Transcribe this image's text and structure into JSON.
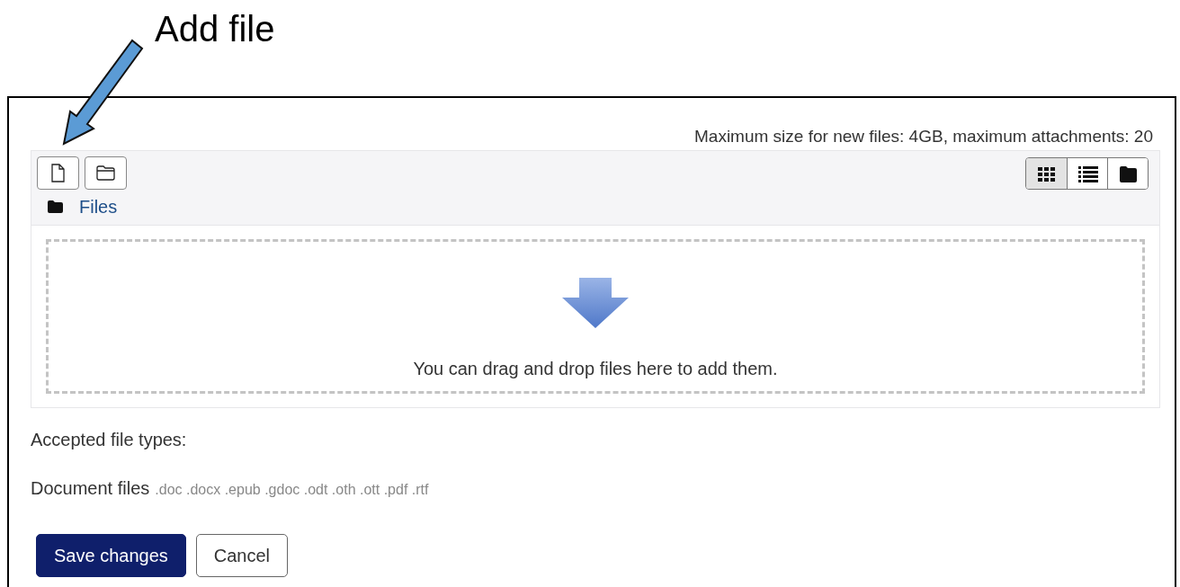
{
  "annotation": {
    "label": "Add file"
  },
  "limits": "Maximum size for new files: 4GB, maximum attachments: 20",
  "toolbar": [
    {
      "kind": "file"
    },
    {
      "kind": "folder"
    }
  ],
  "views": [
    {
      "kind": "grid",
      "selected": true
    },
    {
      "kind": "list",
      "selected": false
    },
    {
      "kind": "tree",
      "selected": false
    }
  ],
  "path": {
    "label": "Files"
  },
  "dropzone": {
    "message": "You can drag and drop files here to add them."
  },
  "accepted": {
    "heading": "Accepted file types:",
    "group": "Document files",
    "extensions": ".doc .docx .epub .gdoc .odt .oth .ott .pdf .rtf"
  },
  "buttons": [
    {
      "label": "Save changes",
      "kind": "primary"
    },
    {
      "label": "Cancel",
      "kind": "secondary"
    }
  ]
}
